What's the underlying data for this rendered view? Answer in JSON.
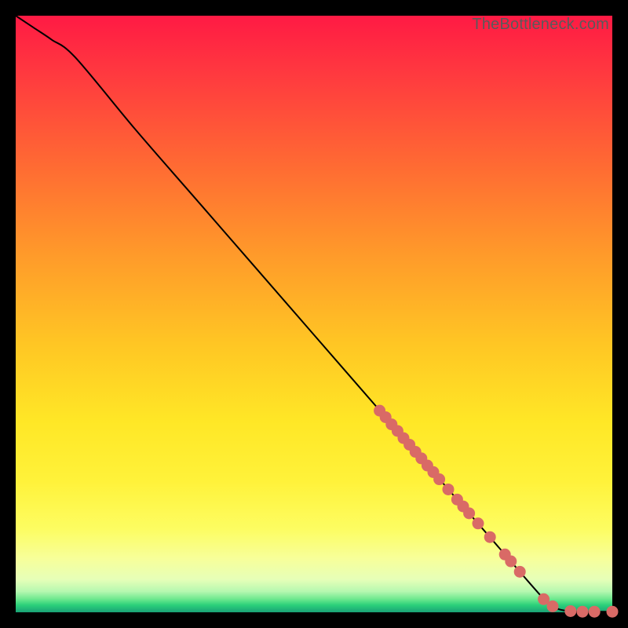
{
  "watermark": "TheBottleneck.com",
  "colors": {
    "marker": "#d96a66",
    "line": "#000000",
    "frame_bg": "#000000"
  },
  "chart_data": {
    "type": "line",
    "title": "",
    "xlabel": "",
    "ylabel": "",
    "xlim": [
      0,
      100
    ],
    "ylim": [
      0,
      100
    ],
    "grid": false,
    "legend": false,
    "curve": {
      "x": [
        0,
        3,
        6,
        10,
        20,
        30,
        40,
        50,
        60,
        70,
        80,
        88,
        90,
        92,
        95,
        97,
        100
      ],
      "y": [
        100,
        98,
        96,
        93,
        81,
        69.5,
        58,
        46.5,
        35,
        23.5,
        12,
        2.8,
        1.0,
        0.3,
        0.1,
        0.1,
        0.1
      ]
    },
    "markers": {
      "x": [
        61,
        62,
        63,
        64,
        65,
        66,
        67,
        68,
        69,
        70,
        71,
        72.5,
        74,
        75,
        76,
        77.5,
        79.5,
        82,
        83,
        84.5,
        88.5,
        90,
        93,
        95,
        97,
        100
      ],
      "y": [
        33.8,
        32.7,
        31.5,
        30.4,
        29.2,
        28.1,
        26.9,
        25.8,
        24.6,
        23.5,
        22.3,
        20.6,
        18.9,
        17.75,
        16.6,
        14.9,
        12.6,
        9.7,
        8.55,
        6.8,
        2.2,
        1.0,
        0.2,
        0.1,
        0.1,
        0.1
      ]
    },
    "gradient_stops": [
      {
        "offset": 0.0,
        "color": "#ff1a44"
      },
      {
        "offset": 0.1,
        "color": "#ff3a3f"
      },
      {
        "offset": 0.25,
        "color": "#ff6a33"
      },
      {
        "offset": 0.4,
        "color": "#ff9a2a"
      },
      {
        "offset": 0.55,
        "color": "#ffc624"
      },
      {
        "offset": 0.68,
        "color": "#ffe726"
      },
      {
        "offset": 0.78,
        "color": "#fff23a"
      },
      {
        "offset": 0.86,
        "color": "#fdfd61"
      },
      {
        "offset": 0.91,
        "color": "#f7ff9a"
      },
      {
        "offset": 0.945,
        "color": "#e6ffb8"
      },
      {
        "offset": 0.965,
        "color": "#b6f8b0"
      },
      {
        "offset": 0.978,
        "color": "#6de88e"
      },
      {
        "offset": 0.988,
        "color": "#2bd07a"
      },
      {
        "offset": 1.0,
        "color": "#1aa276"
      }
    ]
  }
}
